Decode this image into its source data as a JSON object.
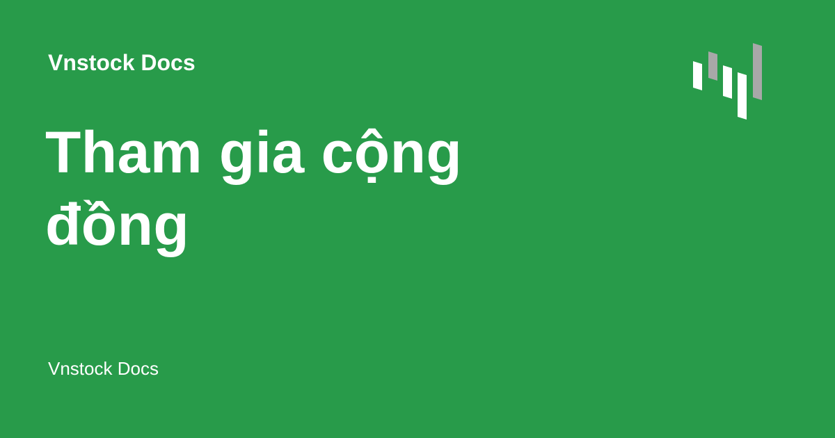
{
  "header": {
    "site_name": "Vnstock Docs"
  },
  "main": {
    "title": "Tham gia cộng đồng"
  },
  "footer": {
    "site_name": "Vnstock Docs"
  },
  "logo": {
    "icon": "vnstock-bars-logo-icon",
    "colors": {
      "light": "#ffffff",
      "grey": "#a8a8a8"
    }
  },
  "colors": {
    "background": "#289b4a",
    "text": "#ffffff"
  }
}
